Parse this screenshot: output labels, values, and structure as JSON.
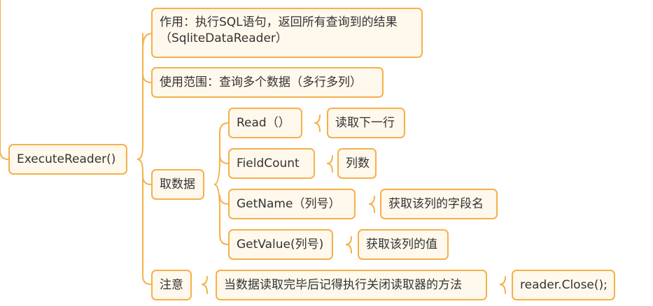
{
  "root": {
    "label": "ExecuteReader()"
  },
  "branches": {
    "purpose": {
      "line1": "作用：执行SQL语句，返回所有查询到的结果",
      "line2": "（SqliteDataReader）"
    },
    "scope": {
      "label": "使用范围：查询多个数据（多行多列）"
    },
    "fetch": {
      "label": "取数据",
      "items": [
        {
          "method": "Read（）",
          "desc": "读取下一行"
        },
        {
          "method": "FieldCount",
          "desc": "列数"
        },
        {
          "method": "GetName（列号）",
          "desc": "获取该列的字段名"
        },
        {
          "method": "GetValue(列号)",
          "desc": "获取该列的值"
        }
      ]
    },
    "note": {
      "label": "注意",
      "text": "当数据读取完毕后记得执行关闭读取器的方法",
      "code": "reader.Close();"
    }
  },
  "colors": {
    "line": "#F5B04B",
    "fill": "#FFF8EC",
    "text": "#333333"
  }
}
